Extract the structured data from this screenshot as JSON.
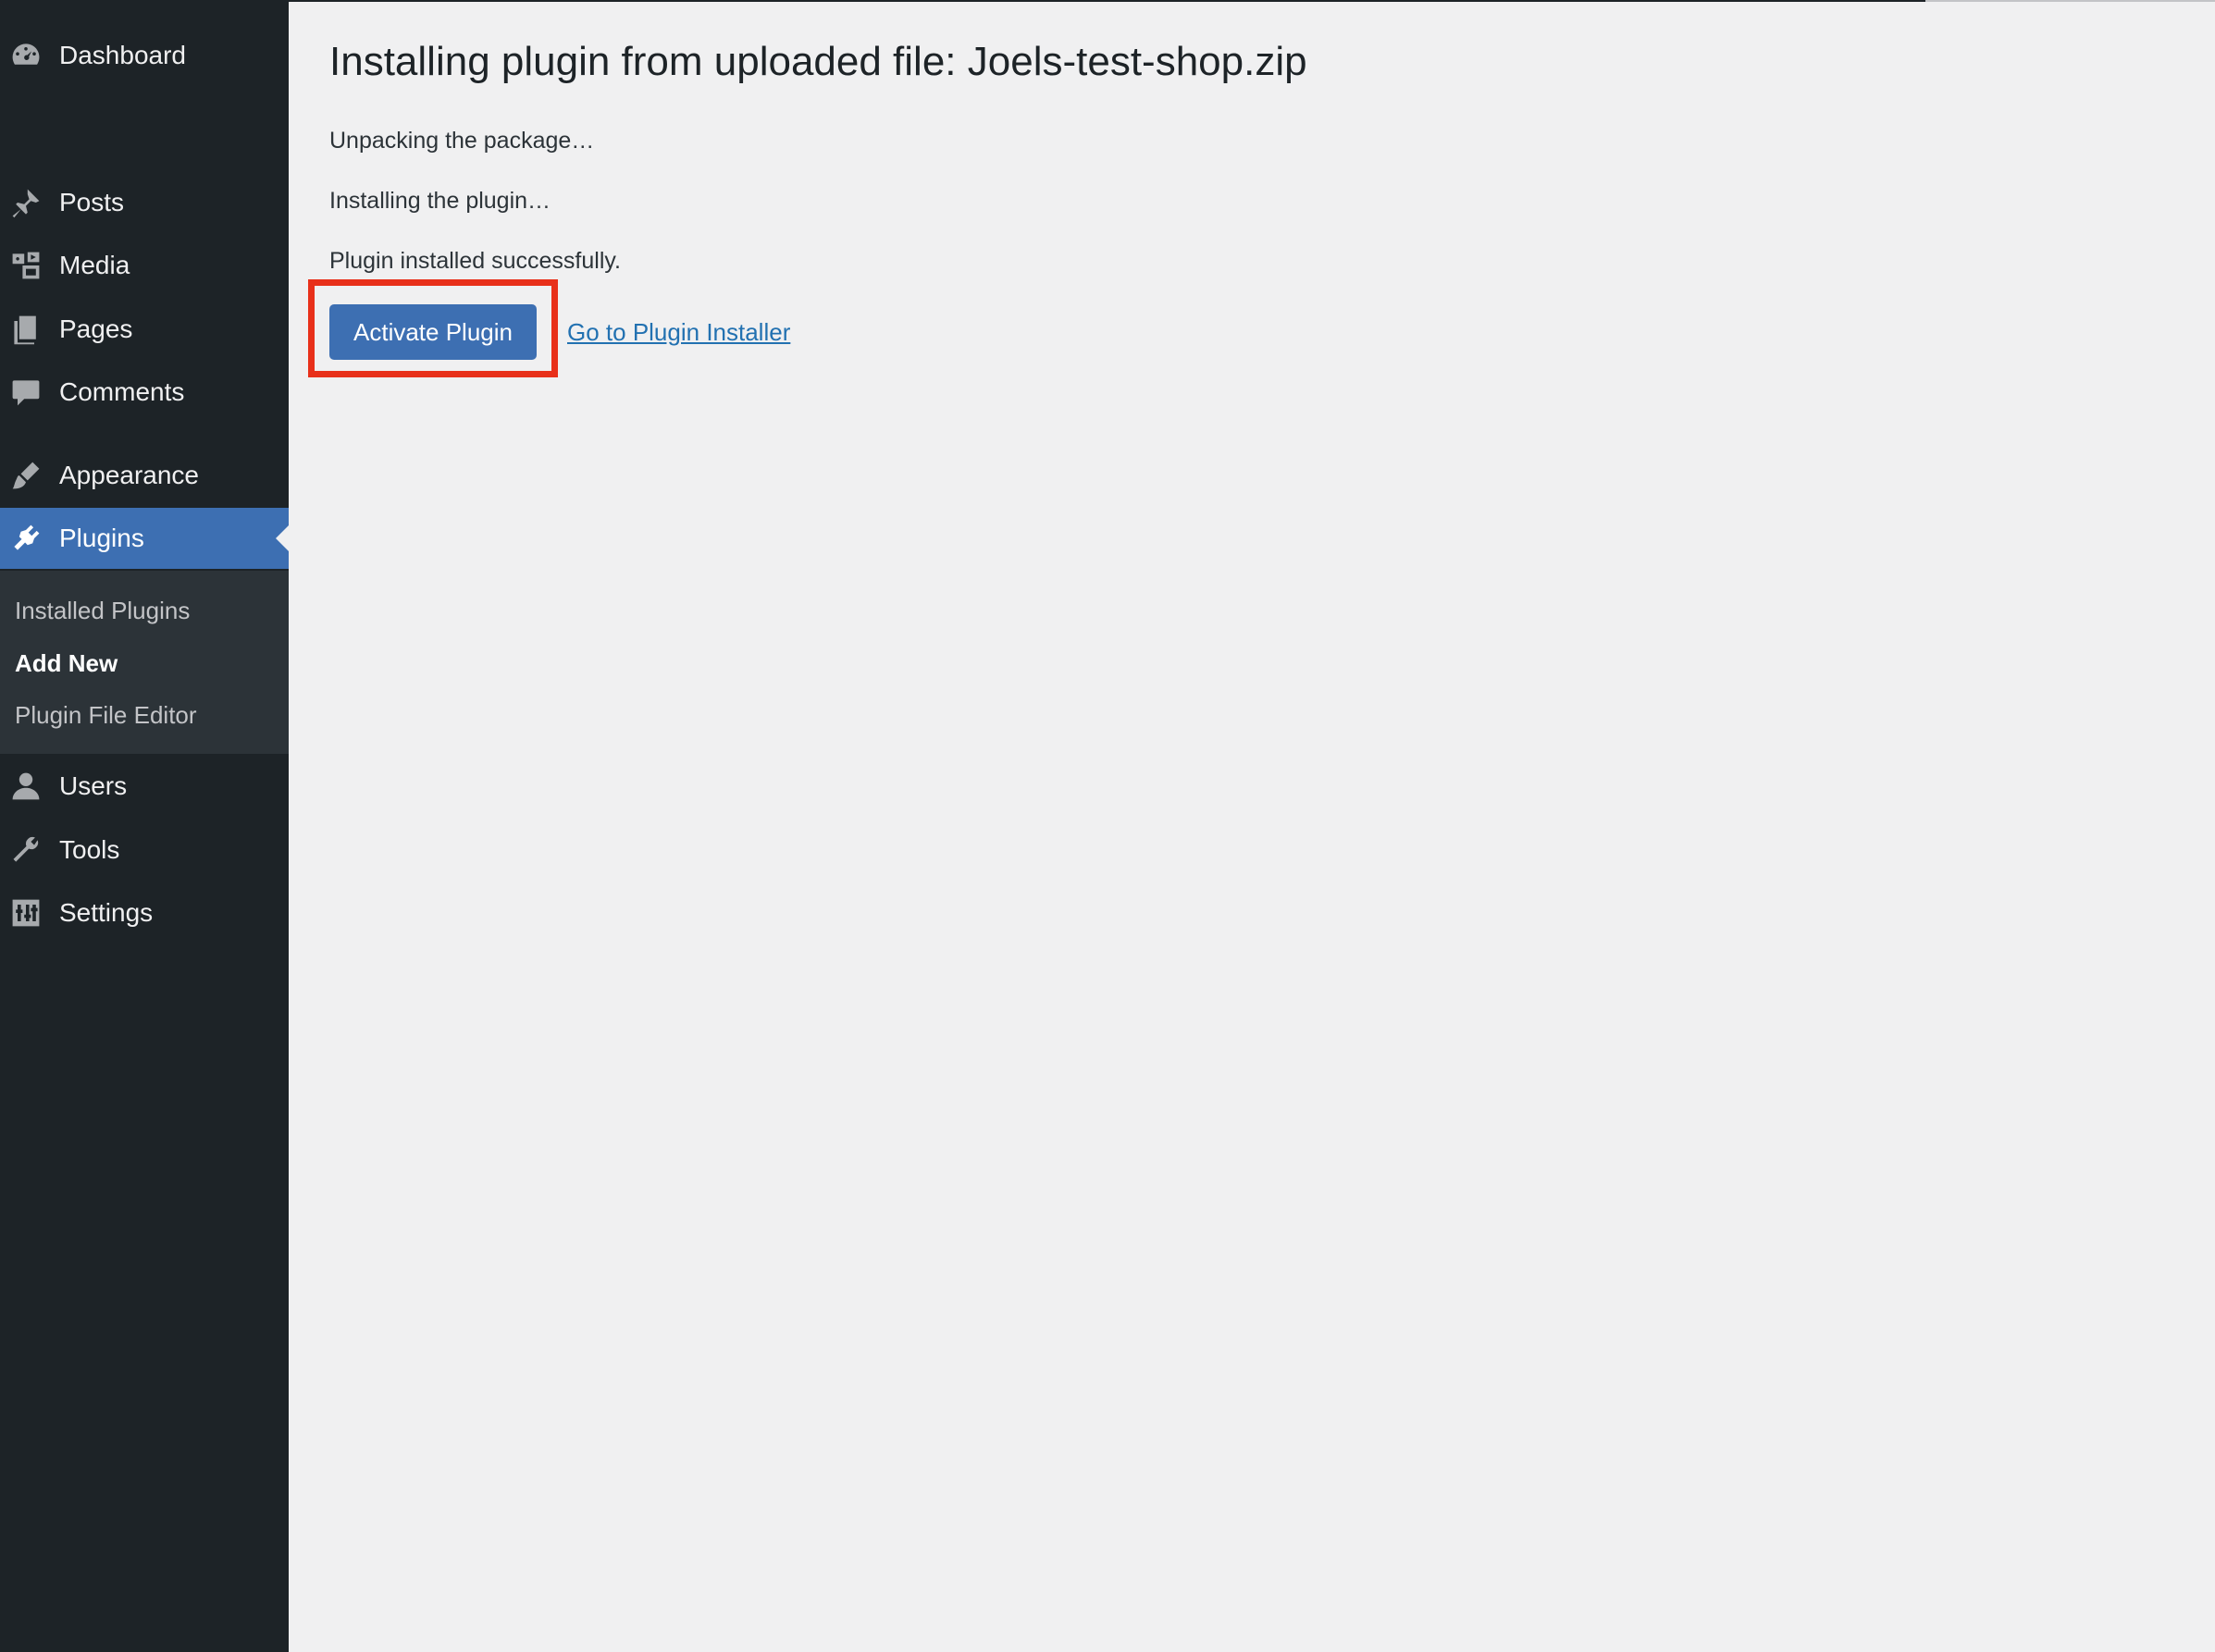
{
  "sidebar": {
    "items": [
      {
        "label": "Dashboard",
        "icon": "dashboard-icon"
      },
      {
        "label": "Posts",
        "icon": "pushpin-icon"
      },
      {
        "label": "Media",
        "icon": "media-icon"
      },
      {
        "label": "Pages",
        "icon": "pages-icon"
      },
      {
        "label": "Comments",
        "icon": "comment-icon"
      },
      {
        "label": "Appearance",
        "icon": "paintbrush-icon"
      },
      {
        "label": "Plugins",
        "icon": "plugin-icon",
        "active": true
      },
      {
        "label": "Users",
        "icon": "user-icon"
      },
      {
        "label": "Tools",
        "icon": "wrench-icon"
      },
      {
        "label": "Settings",
        "icon": "settings-icon"
      }
    ],
    "submenu": [
      {
        "label": "Installed Plugins"
      },
      {
        "label": "Add New",
        "current": true
      },
      {
        "label": "Plugin File Editor"
      }
    ]
  },
  "main": {
    "title": "Installing plugin from uploaded file: Joels-test-shop.zip",
    "messages": [
      "Unpacking the package…",
      "Installing the plugin…",
      "Plugin installed successfully."
    ],
    "activate_button": "Activate Plugin",
    "installer_link": "Go to Plugin Installer"
  },
  "colors": {
    "sidebar_bg": "#1d2327",
    "submenu_bg": "#2c3338",
    "accent": "#3d6fb2",
    "link": "#2271b1",
    "page_bg": "#f0f0f1",
    "highlight": "#e8301a"
  }
}
